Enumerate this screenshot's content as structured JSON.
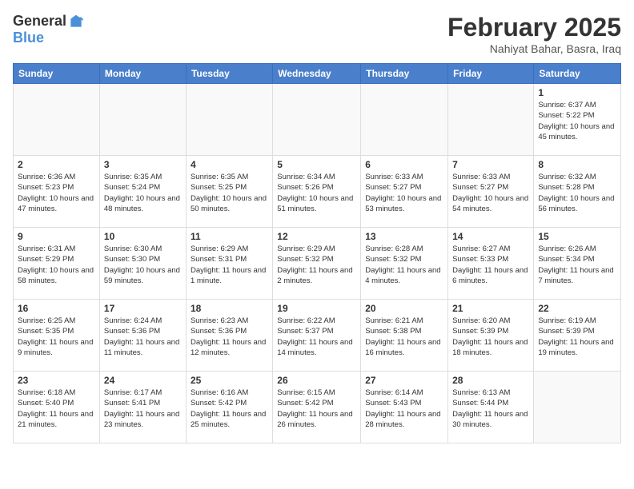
{
  "logo": {
    "general": "General",
    "blue": "Blue"
  },
  "title": "February 2025",
  "location": "Nahiyat Bahar, Basra, Iraq",
  "weekdays": [
    "Sunday",
    "Monday",
    "Tuesday",
    "Wednesday",
    "Thursday",
    "Friday",
    "Saturday"
  ],
  "weeks": [
    [
      {
        "day": "",
        "info": ""
      },
      {
        "day": "",
        "info": ""
      },
      {
        "day": "",
        "info": ""
      },
      {
        "day": "",
        "info": ""
      },
      {
        "day": "",
        "info": ""
      },
      {
        "day": "",
        "info": ""
      },
      {
        "day": "1",
        "info": "Sunrise: 6:37 AM\nSunset: 5:22 PM\nDaylight: 10 hours and 45 minutes."
      }
    ],
    [
      {
        "day": "2",
        "info": "Sunrise: 6:36 AM\nSunset: 5:23 PM\nDaylight: 10 hours and 47 minutes."
      },
      {
        "day": "3",
        "info": "Sunrise: 6:35 AM\nSunset: 5:24 PM\nDaylight: 10 hours and 48 minutes."
      },
      {
        "day": "4",
        "info": "Sunrise: 6:35 AM\nSunset: 5:25 PM\nDaylight: 10 hours and 50 minutes."
      },
      {
        "day": "5",
        "info": "Sunrise: 6:34 AM\nSunset: 5:26 PM\nDaylight: 10 hours and 51 minutes."
      },
      {
        "day": "6",
        "info": "Sunrise: 6:33 AM\nSunset: 5:27 PM\nDaylight: 10 hours and 53 minutes."
      },
      {
        "day": "7",
        "info": "Sunrise: 6:33 AM\nSunset: 5:27 PM\nDaylight: 10 hours and 54 minutes."
      },
      {
        "day": "8",
        "info": "Sunrise: 6:32 AM\nSunset: 5:28 PM\nDaylight: 10 hours and 56 minutes."
      }
    ],
    [
      {
        "day": "9",
        "info": "Sunrise: 6:31 AM\nSunset: 5:29 PM\nDaylight: 10 hours and 58 minutes."
      },
      {
        "day": "10",
        "info": "Sunrise: 6:30 AM\nSunset: 5:30 PM\nDaylight: 10 hours and 59 minutes."
      },
      {
        "day": "11",
        "info": "Sunrise: 6:29 AM\nSunset: 5:31 PM\nDaylight: 11 hours and 1 minute."
      },
      {
        "day": "12",
        "info": "Sunrise: 6:29 AM\nSunset: 5:32 PM\nDaylight: 11 hours and 2 minutes."
      },
      {
        "day": "13",
        "info": "Sunrise: 6:28 AM\nSunset: 5:32 PM\nDaylight: 11 hours and 4 minutes."
      },
      {
        "day": "14",
        "info": "Sunrise: 6:27 AM\nSunset: 5:33 PM\nDaylight: 11 hours and 6 minutes."
      },
      {
        "day": "15",
        "info": "Sunrise: 6:26 AM\nSunset: 5:34 PM\nDaylight: 11 hours and 7 minutes."
      }
    ],
    [
      {
        "day": "16",
        "info": "Sunrise: 6:25 AM\nSunset: 5:35 PM\nDaylight: 11 hours and 9 minutes."
      },
      {
        "day": "17",
        "info": "Sunrise: 6:24 AM\nSunset: 5:36 PM\nDaylight: 11 hours and 11 minutes."
      },
      {
        "day": "18",
        "info": "Sunrise: 6:23 AM\nSunset: 5:36 PM\nDaylight: 11 hours and 12 minutes."
      },
      {
        "day": "19",
        "info": "Sunrise: 6:22 AM\nSunset: 5:37 PM\nDaylight: 11 hours and 14 minutes."
      },
      {
        "day": "20",
        "info": "Sunrise: 6:21 AM\nSunset: 5:38 PM\nDaylight: 11 hours and 16 minutes."
      },
      {
        "day": "21",
        "info": "Sunrise: 6:20 AM\nSunset: 5:39 PM\nDaylight: 11 hours and 18 minutes."
      },
      {
        "day": "22",
        "info": "Sunrise: 6:19 AM\nSunset: 5:39 PM\nDaylight: 11 hours and 19 minutes."
      }
    ],
    [
      {
        "day": "23",
        "info": "Sunrise: 6:18 AM\nSunset: 5:40 PM\nDaylight: 11 hours and 21 minutes."
      },
      {
        "day": "24",
        "info": "Sunrise: 6:17 AM\nSunset: 5:41 PM\nDaylight: 11 hours and 23 minutes."
      },
      {
        "day": "25",
        "info": "Sunrise: 6:16 AM\nSunset: 5:42 PM\nDaylight: 11 hours and 25 minutes."
      },
      {
        "day": "26",
        "info": "Sunrise: 6:15 AM\nSunset: 5:42 PM\nDaylight: 11 hours and 26 minutes."
      },
      {
        "day": "27",
        "info": "Sunrise: 6:14 AM\nSunset: 5:43 PM\nDaylight: 11 hours and 28 minutes."
      },
      {
        "day": "28",
        "info": "Sunrise: 6:13 AM\nSunset: 5:44 PM\nDaylight: 11 hours and 30 minutes."
      },
      {
        "day": "",
        "info": ""
      }
    ]
  ]
}
